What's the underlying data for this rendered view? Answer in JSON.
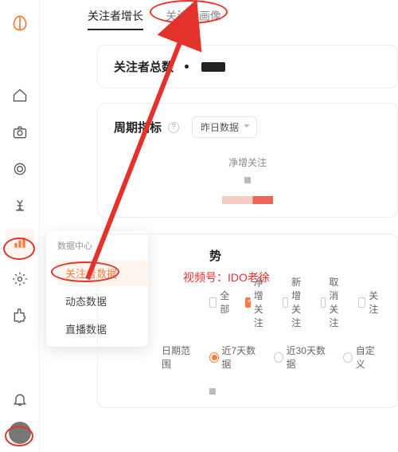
{
  "sidebar": {
    "submenu_title": "数据中心",
    "submenu_items": [
      "关注者数据",
      "动态数据",
      "直播数据"
    ]
  },
  "tabs": {
    "growth": "关注者增长",
    "portrait": "关注者画像"
  },
  "total_card": {
    "label": "关注者总数"
  },
  "period": {
    "label": "周期指标",
    "select": "昨日数据",
    "metric": "净增关注"
  },
  "trend": {
    "title_suffix": "势",
    "options": [
      "全部",
      "净增关注",
      "新增关注",
      "取消关注",
      "关注"
    ],
    "checked_index": 1,
    "range_label": "日期范围",
    "ranges": [
      "近7天数据",
      "近30天数据",
      "自定义"
    ],
    "range_checked": 0
  },
  "watermark": "视频号：IDO老徐"
}
